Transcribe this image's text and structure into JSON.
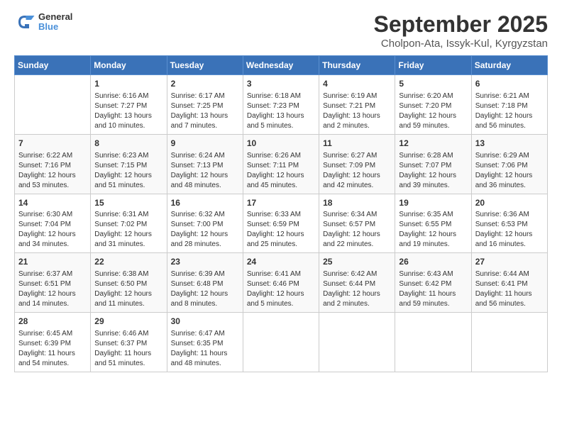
{
  "logo": {
    "line1": "General",
    "line2": "Blue"
  },
  "title": "September 2025",
  "subtitle": "Cholpon-Ata, Issyk-Kul, Kyrgyzstan",
  "days_of_week": [
    "Sunday",
    "Monday",
    "Tuesday",
    "Wednesday",
    "Thursday",
    "Friday",
    "Saturday"
  ],
  "weeks": [
    [
      {
        "day": "",
        "info": ""
      },
      {
        "day": "1",
        "info": "Sunrise: 6:16 AM\nSunset: 7:27 PM\nDaylight: 13 hours\nand 10 minutes."
      },
      {
        "day": "2",
        "info": "Sunrise: 6:17 AM\nSunset: 7:25 PM\nDaylight: 13 hours\nand 7 minutes."
      },
      {
        "day": "3",
        "info": "Sunrise: 6:18 AM\nSunset: 7:23 PM\nDaylight: 13 hours\nand 5 minutes."
      },
      {
        "day": "4",
        "info": "Sunrise: 6:19 AM\nSunset: 7:21 PM\nDaylight: 13 hours\nand 2 minutes."
      },
      {
        "day": "5",
        "info": "Sunrise: 6:20 AM\nSunset: 7:20 PM\nDaylight: 12 hours\nand 59 minutes."
      },
      {
        "day": "6",
        "info": "Sunrise: 6:21 AM\nSunset: 7:18 PM\nDaylight: 12 hours\nand 56 minutes."
      }
    ],
    [
      {
        "day": "7",
        "info": "Sunrise: 6:22 AM\nSunset: 7:16 PM\nDaylight: 12 hours\nand 53 minutes."
      },
      {
        "day": "8",
        "info": "Sunrise: 6:23 AM\nSunset: 7:15 PM\nDaylight: 12 hours\nand 51 minutes."
      },
      {
        "day": "9",
        "info": "Sunrise: 6:24 AM\nSunset: 7:13 PM\nDaylight: 12 hours\nand 48 minutes."
      },
      {
        "day": "10",
        "info": "Sunrise: 6:26 AM\nSunset: 7:11 PM\nDaylight: 12 hours\nand 45 minutes."
      },
      {
        "day": "11",
        "info": "Sunrise: 6:27 AM\nSunset: 7:09 PM\nDaylight: 12 hours\nand 42 minutes."
      },
      {
        "day": "12",
        "info": "Sunrise: 6:28 AM\nSunset: 7:07 PM\nDaylight: 12 hours\nand 39 minutes."
      },
      {
        "day": "13",
        "info": "Sunrise: 6:29 AM\nSunset: 7:06 PM\nDaylight: 12 hours\nand 36 minutes."
      }
    ],
    [
      {
        "day": "14",
        "info": "Sunrise: 6:30 AM\nSunset: 7:04 PM\nDaylight: 12 hours\nand 34 minutes."
      },
      {
        "day": "15",
        "info": "Sunrise: 6:31 AM\nSunset: 7:02 PM\nDaylight: 12 hours\nand 31 minutes."
      },
      {
        "day": "16",
        "info": "Sunrise: 6:32 AM\nSunset: 7:00 PM\nDaylight: 12 hours\nand 28 minutes."
      },
      {
        "day": "17",
        "info": "Sunrise: 6:33 AM\nSunset: 6:59 PM\nDaylight: 12 hours\nand 25 minutes."
      },
      {
        "day": "18",
        "info": "Sunrise: 6:34 AM\nSunset: 6:57 PM\nDaylight: 12 hours\nand 22 minutes."
      },
      {
        "day": "19",
        "info": "Sunrise: 6:35 AM\nSunset: 6:55 PM\nDaylight: 12 hours\nand 19 minutes."
      },
      {
        "day": "20",
        "info": "Sunrise: 6:36 AM\nSunset: 6:53 PM\nDaylight: 12 hours\nand 16 minutes."
      }
    ],
    [
      {
        "day": "21",
        "info": "Sunrise: 6:37 AM\nSunset: 6:51 PM\nDaylight: 12 hours\nand 14 minutes."
      },
      {
        "day": "22",
        "info": "Sunrise: 6:38 AM\nSunset: 6:50 PM\nDaylight: 12 hours\nand 11 minutes."
      },
      {
        "day": "23",
        "info": "Sunrise: 6:39 AM\nSunset: 6:48 PM\nDaylight: 12 hours\nand 8 minutes."
      },
      {
        "day": "24",
        "info": "Sunrise: 6:41 AM\nSunset: 6:46 PM\nDaylight: 12 hours\nand 5 minutes."
      },
      {
        "day": "25",
        "info": "Sunrise: 6:42 AM\nSunset: 6:44 PM\nDaylight: 12 hours\nand 2 minutes."
      },
      {
        "day": "26",
        "info": "Sunrise: 6:43 AM\nSunset: 6:42 PM\nDaylight: 11 hours\nand 59 minutes."
      },
      {
        "day": "27",
        "info": "Sunrise: 6:44 AM\nSunset: 6:41 PM\nDaylight: 11 hours\nand 56 minutes."
      }
    ],
    [
      {
        "day": "28",
        "info": "Sunrise: 6:45 AM\nSunset: 6:39 PM\nDaylight: 11 hours\nand 54 minutes."
      },
      {
        "day": "29",
        "info": "Sunrise: 6:46 AM\nSunset: 6:37 PM\nDaylight: 11 hours\nand 51 minutes."
      },
      {
        "day": "30",
        "info": "Sunrise: 6:47 AM\nSunset: 6:35 PM\nDaylight: 11 hours\nand 48 minutes."
      },
      {
        "day": "",
        "info": ""
      },
      {
        "day": "",
        "info": ""
      },
      {
        "day": "",
        "info": ""
      },
      {
        "day": "",
        "info": ""
      }
    ]
  ]
}
